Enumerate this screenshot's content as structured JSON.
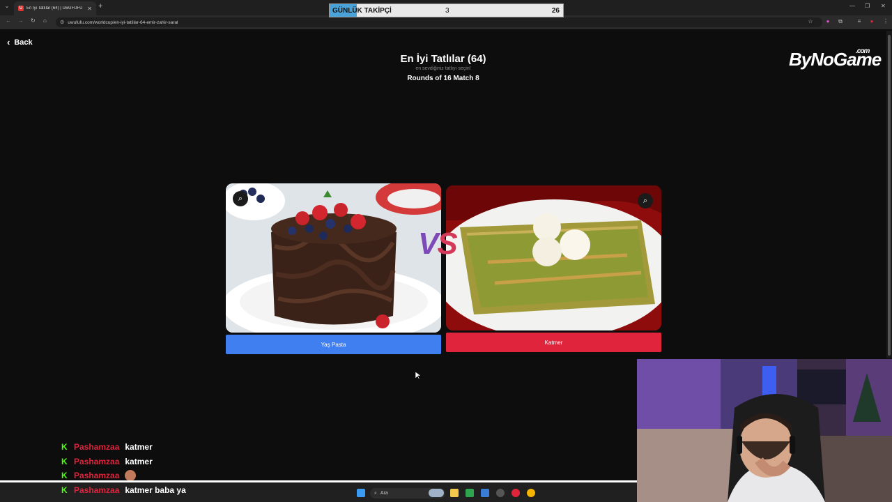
{
  "browser": {
    "tab_title": "En İyi Tatlılar (64) | UwUFUFU",
    "url": "uwufufu.com/worldcup/en-iyi-tatlilar-64-emir-zahir-saral"
  },
  "follower_widget": {
    "label": "GÜNLÜK TAKİPÇİ",
    "current": "3",
    "goal": "26",
    "progress": 0.115
  },
  "page": {
    "back_label": "Back",
    "title": "En İyi Tatlılar (64)",
    "subtitle": "en sevdiğiniz tatlıyı seçin!",
    "round_label": "Rounds of 16 Match 8",
    "brand": "ByNoGame",
    "brand_suffix": ".com"
  },
  "match": {
    "vs_left": "V",
    "vs_right": "S",
    "left": {
      "label": "Yaş Pasta",
      "color": "#3f7fef"
    },
    "right": {
      "label": "Katmer",
      "color": "#e0243c"
    }
  },
  "chat": [
    {
      "user": "Pashamzaa",
      "message": "katmer"
    },
    {
      "user": "Pashamzaa",
      "message": "katmer"
    },
    {
      "user": "Pashamzaa",
      "message": ""
    },
    {
      "user": "Pashamzaa",
      "message": "katmer baba ya"
    }
  ],
  "taskbar": {
    "search_placeholder": "Ara"
  }
}
